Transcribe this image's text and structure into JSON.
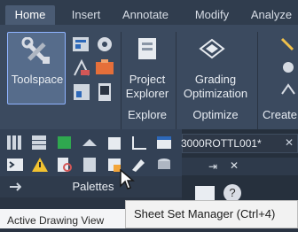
{
  "ribbon": {
    "tabs": [
      {
        "label": "Home"
      },
      {
        "label": "Insert"
      },
      {
        "label": "Annotate"
      },
      {
        "label": "Modify"
      },
      {
        "label": "Analyze"
      }
    ],
    "active_tab": "Home",
    "panels": {
      "palettes": {
        "toolspace_label": "Toolspace",
        "title": "Palettes"
      },
      "explore": {
        "button_line1": "Project",
        "button_line2": "Explorer",
        "title": "Explore"
      },
      "optimize": {
        "button_line1": "Grading",
        "button_line2": "Optimization",
        "title": "Optimize"
      },
      "create": {
        "title": "Create"
      }
    }
  },
  "document_tab": {
    "title": "3000ROTTL001*"
  },
  "status_bar": {
    "text": "Active Drawing View"
  },
  "tooltip": {
    "title": "Sheet Set Manager",
    "shortcut": "(Ctrl+4)"
  },
  "colors": {
    "ribbon_bg": "#3b4a5f",
    "tab_bar": "#303d4e",
    "selected_blue": "#8fb3ff",
    "tooltip_bg": "#f2f2f2"
  }
}
